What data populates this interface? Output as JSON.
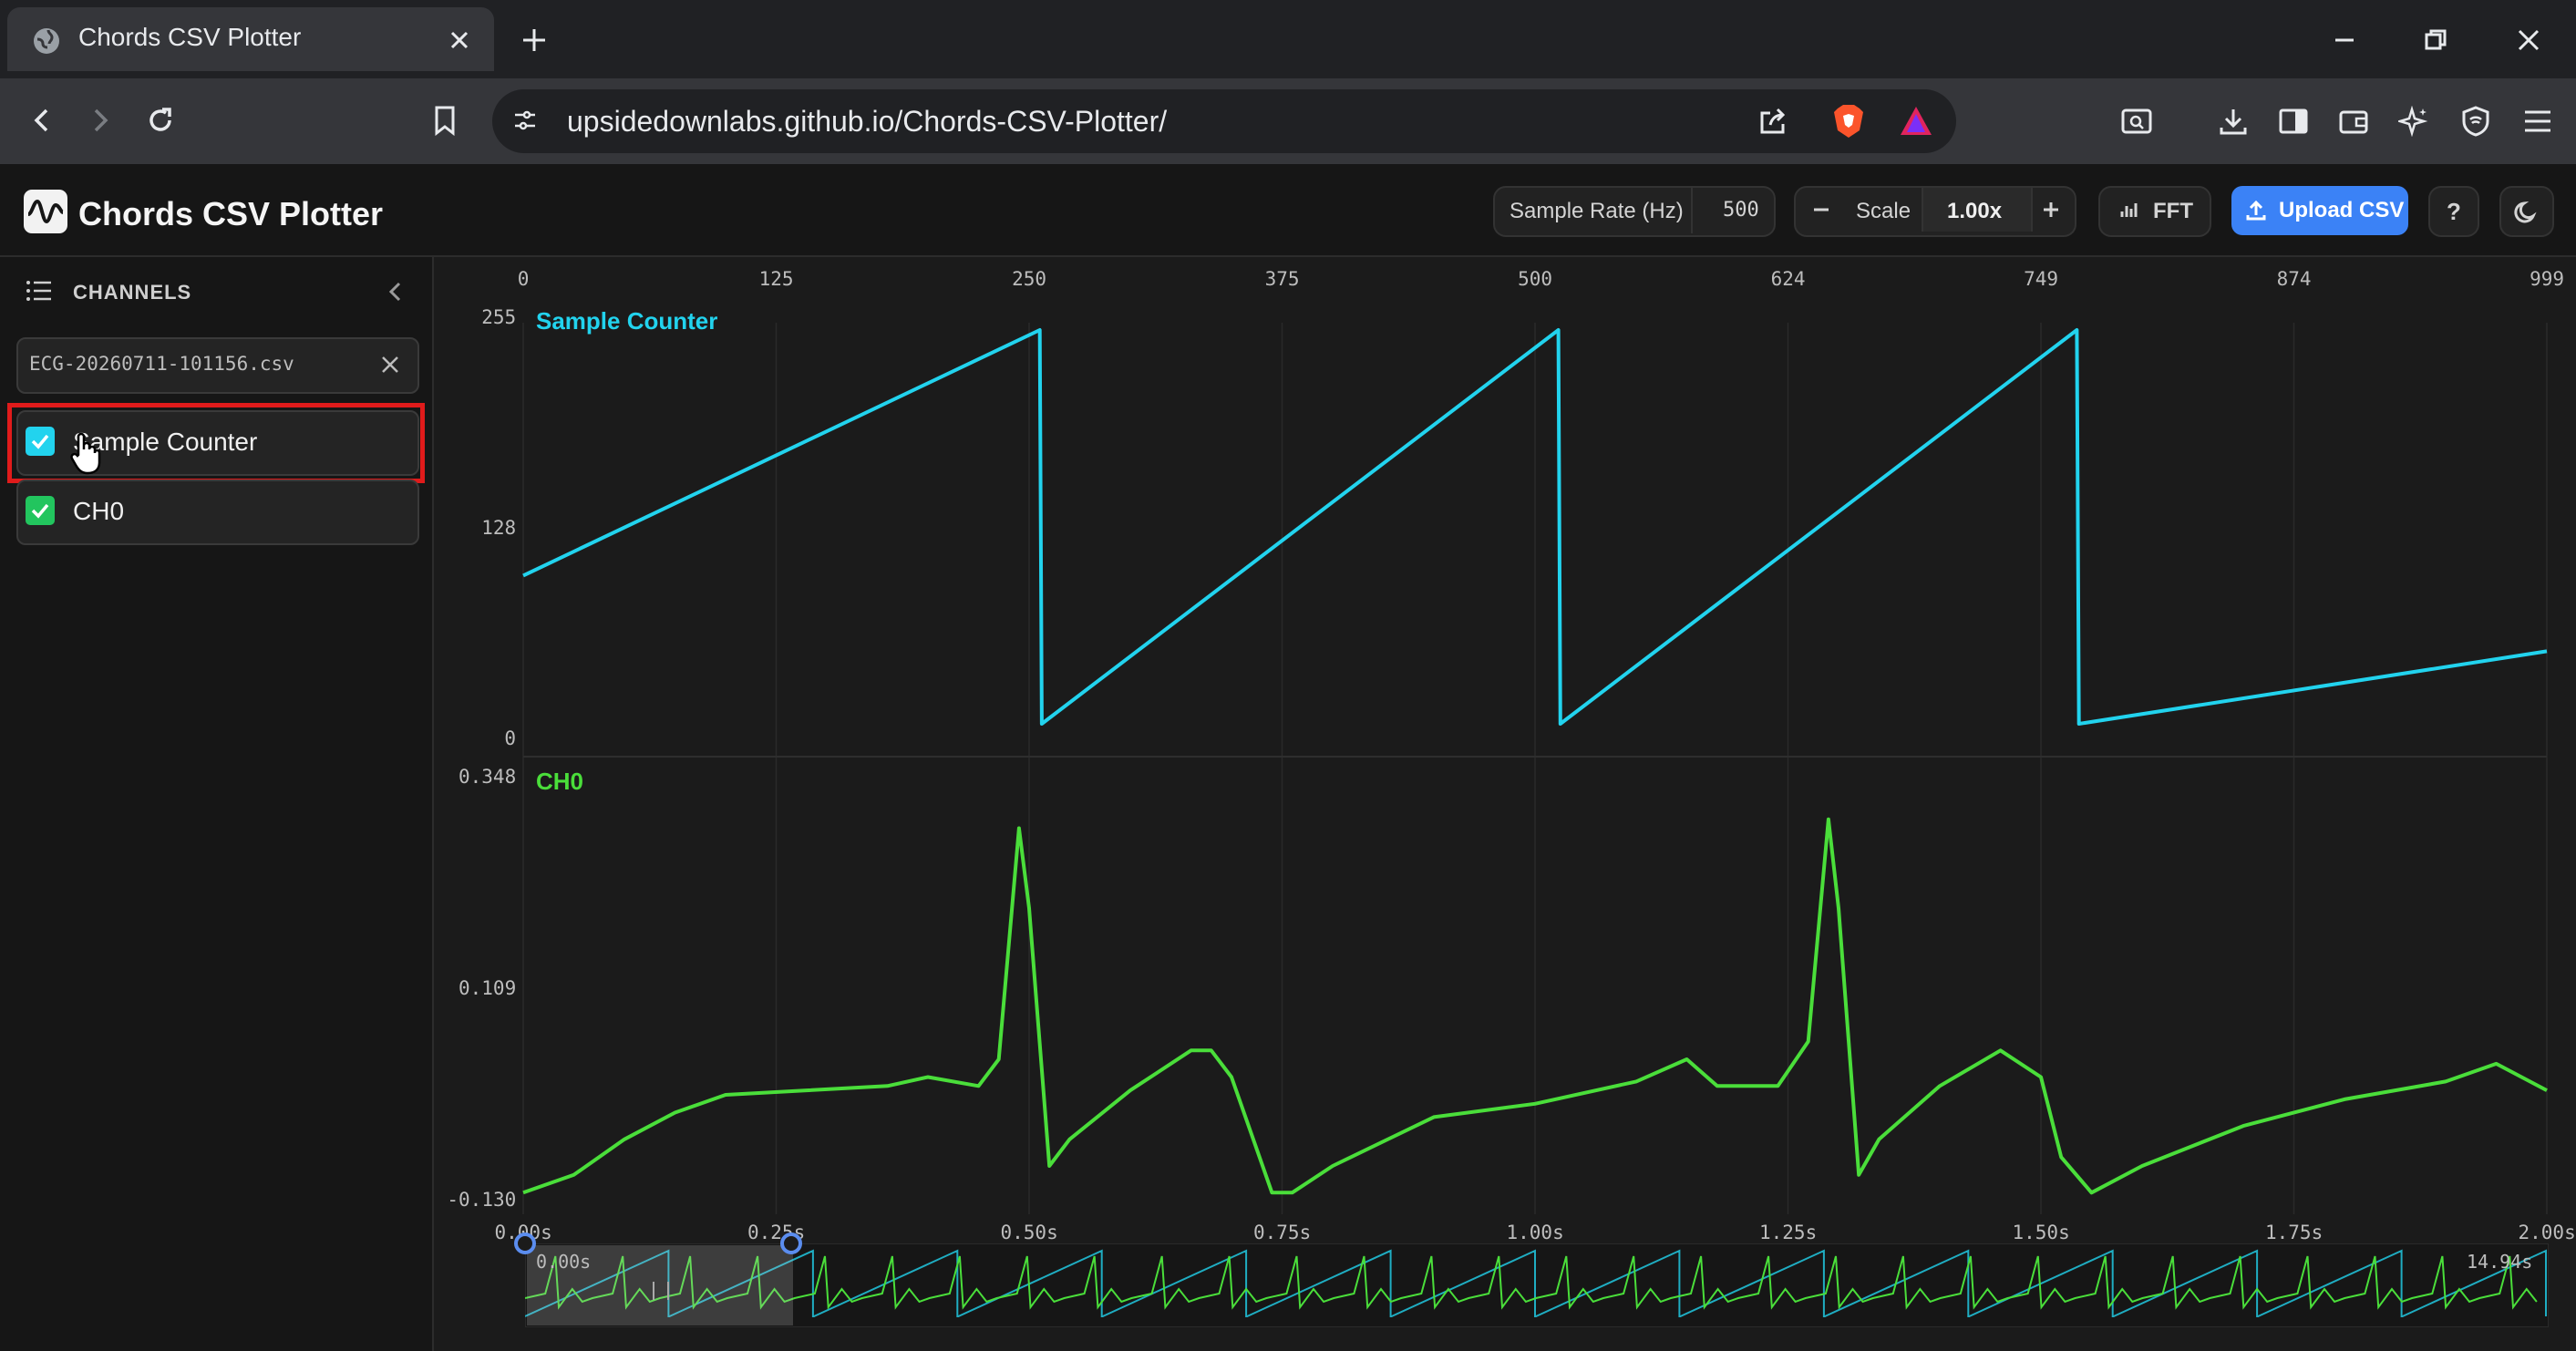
{
  "browser": {
    "tab_title": "Chords CSV Plotter",
    "url": "upsidedownlabs.github.io/Chords-CSV-Plotter/"
  },
  "app": {
    "title": "Chords CSV Plotter",
    "sample_rate_label": "Sample Rate (Hz)",
    "sample_rate_value": "500",
    "scale_label": "Scale",
    "scale_value": "1.00x",
    "fft_label": "FFT",
    "upload_label": "Upload CSV",
    "help_label": "?"
  },
  "sidebar": {
    "heading": "CHANNELS",
    "file_name": "ECG-20260711-101156.csv",
    "channels": [
      {
        "label": "Sample Counter",
        "checked": true,
        "color": "#22d3ee"
      },
      {
        "label": "CH0",
        "checked": true,
        "color": "#22c55e"
      }
    ]
  },
  "plot": {
    "top_sample_ticks": [
      "0",
      "125",
      "250",
      "375",
      "500",
      "624",
      "749",
      "874",
      "999"
    ],
    "bottom_time_ticks": [
      "0.00s",
      "0.25s",
      "0.50s",
      "0.75s",
      "1.00s",
      "1.25s",
      "1.50s",
      "1.75s",
      "2.00s"
    ],
    "navigator_start": "0.00s",
    "navigator_end": "14.94s"
  },
  "chart_data": [
    {
      "type": "line",
      "title": "Sample Counter",
      "ylim": [
        0,
        255
      ],
      "y_ticks": [
        "255",
        "128",
        "0"
      ],
      "x_range_samples": [
        0,
        999
      ],
      "series": [
        {
          "name": "Sample Counter",
          "color": "#22d3ee",
          "x": [
            0,
            255,
            256,
            511,
            512,
            767,
            768,
            999
          ],
          "y": [
            96,
            255,
            0,
            255,
            0,
            255,
            0,
            47
          ]
        }
      ]
    },
    {
      "type": "line",
      "title": "CH0",
      "ylim": [
        -0.13,
        0.348
      ],
      "y_ticks": [
        "0.348",
        "0.109",
        "-0.130"
      ],
      "x_range_seconds": [
        0,
        2.0
      ],
      "series": [
        {
          "name": "CH0",
          "color": "#4ade3a",
          "x": [
            0,
            0.05,
            0.1,
            0.15,
            0.2,
            0.28,
            0.36,
            0.4,
            0.45,
            0.47,
            0.49,
            0.5,
            0.52,
            0.54,
            0.6,
            0.66,
            0.68,
            0.7,
            0.74,
            0.76,
            0.8,
            0.9,
            1.0,
            1.1,
            1.15,
            1.18,
            1.24,
            1.27,
            1.29,
            1.3,
            1.32,
            1.34,
            1.4,
            1.46,
            1.5,
            1.52,
            1.55,
            1.6,
            1.7,
            1.8,
            1.9,
            1.95,
            2.0
          ],
          "y": [
            -0.12,
            -0.1,
            -0.06,
            -0.03,
            -0.01,
            -0.005,
            0.0,
            0.01,
            0.0,
            0.03,
            0.29,
            0.2,
            -0.09,
            -0.06,
            -0.005,
            0.04,
            0.04,
            0.01,
            -0.12,
            -0.12,
            -0.09,
            -0.035,
            -0.02,
            0.005,
            0.03,
            0.0,
            0.0,
            0.05,
            0.3,
            0.2,
            -0.1,
            -0.06,
            0.0,
            0.04,
            0.01,
            -0.08,
            -0.12,
            -0.09,
            -0.045,
            -0.015,
            0.005,
            0.025,
            -0.005
          ]
        }
      ]
    }
  ]
}
